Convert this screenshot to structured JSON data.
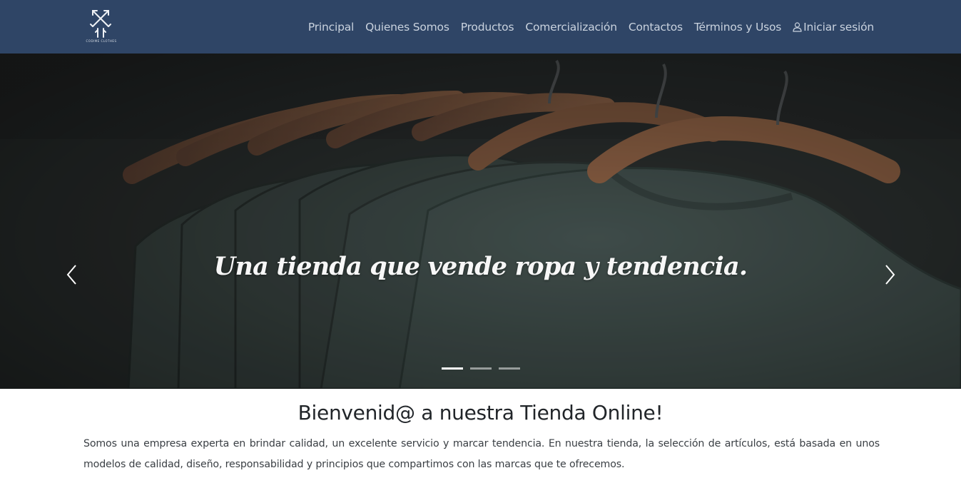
{
  "brand": {
    "logo_text": "CODIME CLOTHES",
    "logo_icon": "crossed-arrows-logo"
  },
  "nav": {
    "items": [
      {
        "label": "Principal"
      },
      {
        "label": "Quienes Somos"
      },
      {
        "label": "Productos"
      },
      {
        "label": "Comercialización"
      },
      {
        "label": "Contactos"
      },
      {
        "label": "Términos y Usos"
      }
    ],
    "login": {
      "label": "Iniciar sesión",
      "icon": "user-icon"
    }
  },
  "carousel": {
    "caption": "Una tienda que vende ropa y tendencia.",
    "prev_icon": "chevron-left-icon",
    "next_icon": "chevron-right-icon",
    "slide_count": 3,
    "active_slide": 1
  },
  "welcome": {
    "title": "Bienvenid@ a nuestra Tienda Online!",
    "text": "Somos una empresa experta en brindar calidad, un excelente servicio y marcar tendencia. En nuestra tienda, la selección de artículos, está basada en unos modelos de calidad, diseño, responsabilidad y principios que compartimos con las marcas que te ofrecemos."
  },
  "colors": {
    "navbar": "#2f4566",
    "nav_text": "#c9d2de",
    "hero_overlay": "#2d3231"
  }
}
